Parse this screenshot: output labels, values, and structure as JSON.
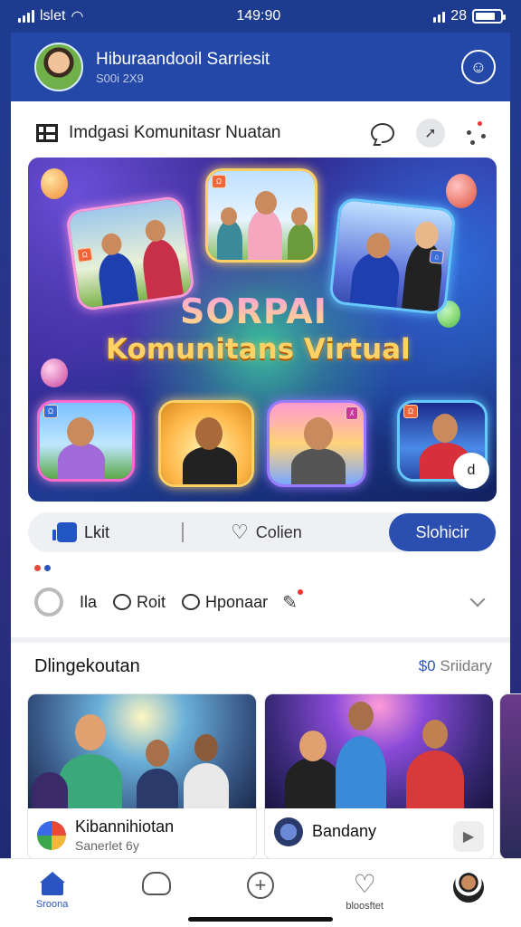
{
  "status_bar": {
    "carrier": "lslet",
    "time": "149:90",
    "signal_text": "28"
  },
  "header": {
    "title": "Hiburaandooil Sarriesit",
    "subtitle": "S00i 2X9"
  },
  "post": {
    "header_text_bold": "Imdgasi",
    "header_text_rest": "Komunitasr Nuatan",
    "hero": {
      "title_line1": "SORPAI",
      "title_line2": "Komunitans Virtual",
      "corner_button": "d"
    },
    "actions": {
      "like": "Lkit",
      "collect": "Colien",
      "share": "Slohicir"
    },
    "reactions": {
      "item1": "Ila",
      "item2": "Roit",
      "item3": "Hponaar"
    }
  },
  "recommendations": {
    "title": "Dlingekoutan",
    "more_num": "$0",
    "more_text": "Sriidary",
    "items": [
      {
        "name": "Kibannihiotan",
        "sub": "Sanerlet 6y"
      },
      {
        "name": "Bandany",
        "sub": ""
      }
    ]
  },
  "bottom_nav": [
    {
      "label": "Sroona"
    },
    {
      "label": ""
    },
    {
      "label": ""
    },
    {
      "label": "bloosftet"
    },
    {
      "label": ""
    }
  ],
  "colors": {
    "primary": "#2448a8",
    "accent": "#2a55c0"
  }
}
